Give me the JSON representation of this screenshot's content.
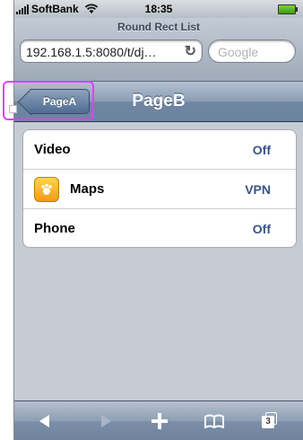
{
  "status": {
    "carrier": "SoftBank",
    "time": "18:35"
  },
  "browser": {
    "page_title": "Round Rect List",
    "url": "192.168.1.5:8080/t/dj…",
    "search_placeholder": "Google"
  },
  "nav": {
    "back_label": "PageA",
    "title": "PageB"
  },
  "list": {
    "rows": [
      {
        "label": "Video",
        "value": "Off"
      },
      {
        "label": "Maps",
        "value": "VPN",
        "icon": "maps-app-icon"
      },
      {
        "label": "Phone",
        "value": "Off"
      }
    ]
  },
  "toolbar": {
    "icons": [
      "back-arrow-icon",
      "forward-arrow-icon",
      "add-icon",
      "bookmarks-icon",
      "pages-icon"
    ],
    "pages_count": "3"
  },
  "colors": {
    "nav_blue": "#6f86a1",
    "value_blue": "#385487",
    "highlight_magenta": "#e040ff"
  }
}
